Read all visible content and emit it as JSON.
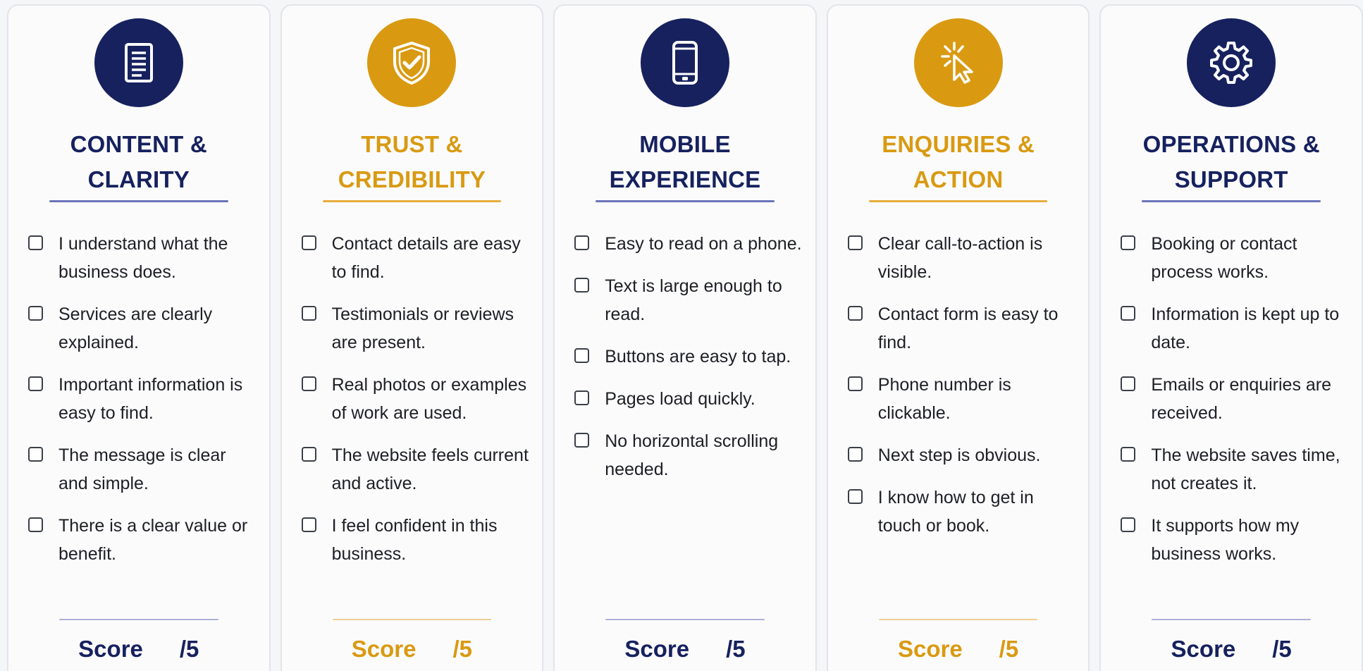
{
  "colors": {
    "navy": "#16215e",
    "gold": "#d99a12"
  },
  "cards": [
    {
      "icon": "document-icon",
      "accent": "navy",
      "title_line1": "CONTENT &",
      "title_line2": "CLARITY",
      "items": [
        "I understand what the business does.",
        "Services are clearly explained.",
        "Important information is easy to find.",
        "The message is clear and simple.",
        "There is a clear value or benefit."
      ],
      "score_label": "Score",
      "score_max": "/5"
    },
    {
      "icon": "shield-check-icon",
      "accent": "gold",
      "title_line1": "TRUST &",
      "title_line2": "CREDIBILITY",
      "items": [
        "Contact details are easy to find.",
        "Testimonials or reviews are present.",
        "Real photos or examples of work are used.",
        "The website feels current and active.",
        "I feel confident in this business."
      ],
      "score_label": "Score",
      "score_max": "/5"
    },
    {
      "icon": "mobile-phone-icon",
      "accent": "navy",
      "title_line1": "MOBILE",
      "title_line2": "EXPERIENCE",
      "items": [
        "Easy to read on a phone.",
        "Text is large enough to read.",
        "Buttons are easy to tap.",
        "Pages load quickly.",
        "No horizontal scrolling needed."
      ],
      "score_label": "Score",
      "score_max": "/5"
    },
    {
      "icon": "cursor-click-icon",
      "accent": "gold",
      "title_line1": "ENQUIRIES &",
      "title_line2": "ACTION",
      "items": [
        "Clear call-to-action is visible.",
        "Contact form is easy to find.",
        "Phone number is clickable.",
        "Next step is obvious.",
        "I know how to get in touch or book."
      ],
      "score_label": "Score",
      "score_max": "/5"
    },
    {
      "icon": "gear-icon",
      "accent": "navy",
      "title_line1": "OPERATIONS &",
      "title_line2": "SUPPORT",
      "items": [
        "Booking or contact process works.",
        "Information is kept up to date.",
        "Emails or enquiries are received.",
        "The website saves time, not creates it.",
        "It supports how my business works."
      ],
      "score_label": "Score",
      "score_max": "/5"
    }
  ]
}
